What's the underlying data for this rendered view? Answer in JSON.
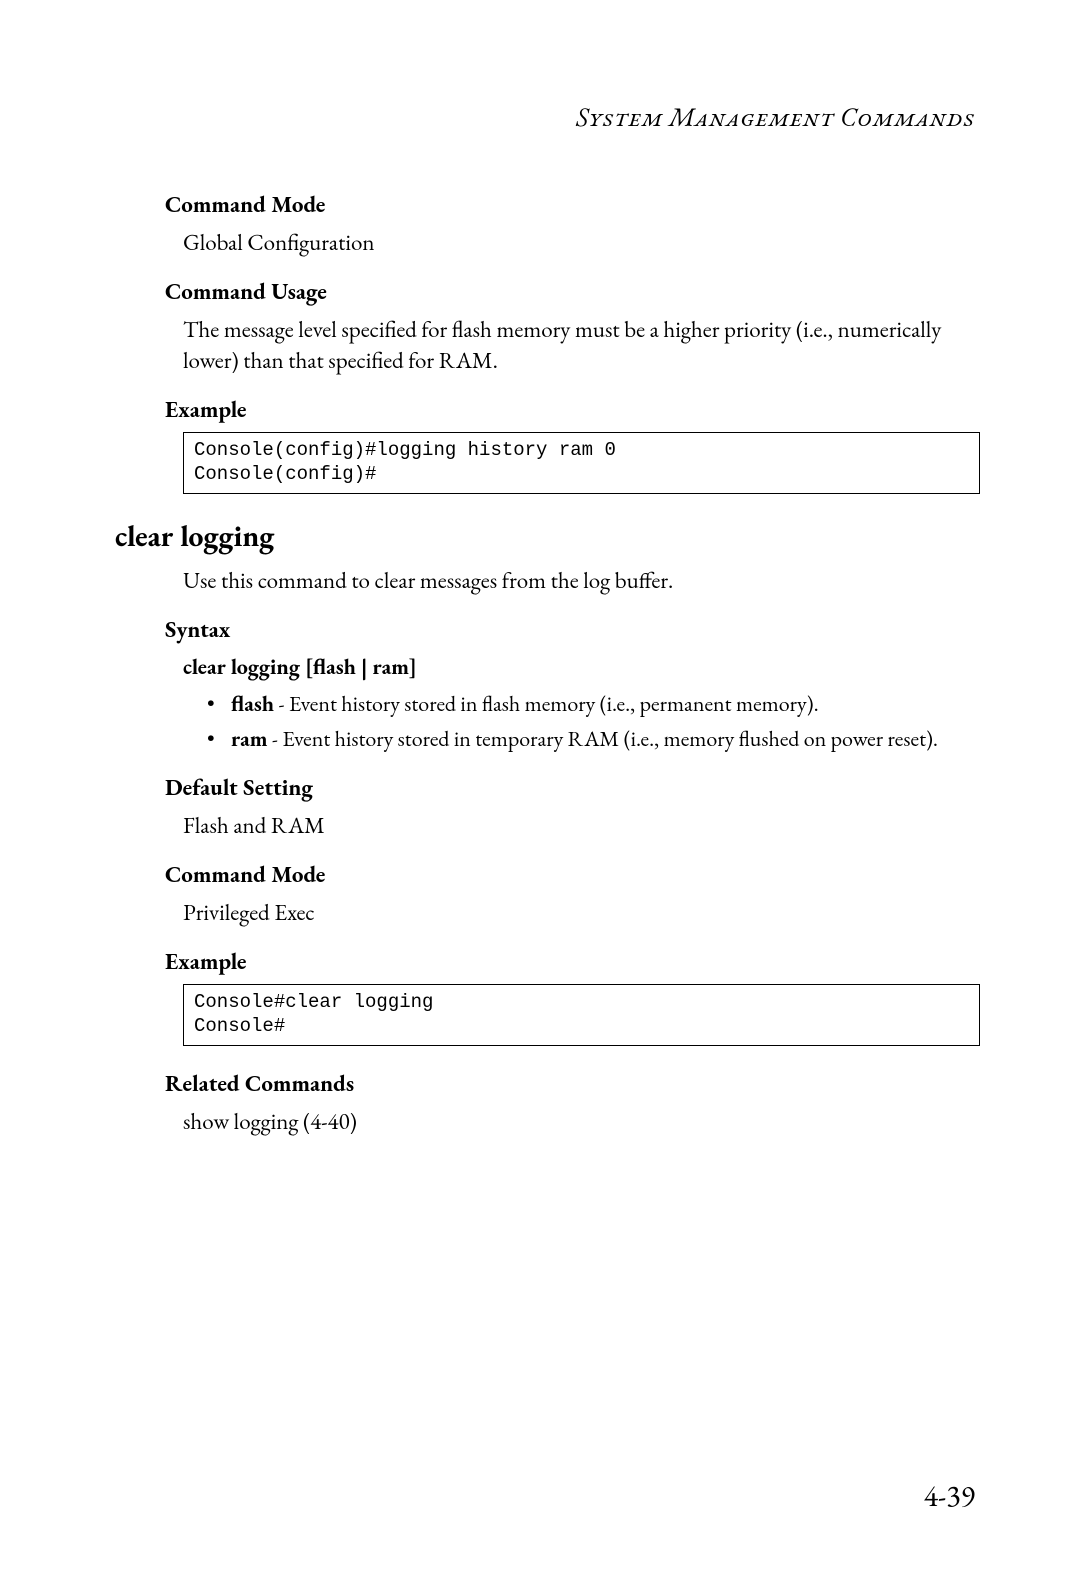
{
  "header": {
    "running_head": "System Management Commands"
  },
  "sections": {
    "cmd_mode_1": {
      "title": "Command Mode",
      "body": "Global Configuration"
    },
    "cmd_usage": {
      "title": "Command Usage",
      "body": "The message level specified for flash memory must be a higher priority (i.e., numerically lower) than that specified for RAM."
    },
    "example_1": {
      "title": "Example",
      "code": "Console(config)#logging history ram 0\nConsole(config)#"
    },
    "clear_logging": {
      "title": "clear logging",
      "intro": "Use this command to clear messages from the log buffer.",
      "syntax_title": "Syntax",
      "syntax_line": "clear logging [flash | ram]",
      "params": {
        "flash": {
          "name": "flash",
          "desc": " - Event history stored in flash memory (i.e., permanent memory)."
        },
        "ram": {
          "name": "ram",
          "desc": " - Event history stored in temporary RAM (i.e., memory flushed on power reset)."
        }
      },
      "default_title": "Default Setting",
      "default_body": "Flash and RAM",
      "mode_title": "Command Mode",
      "mode_body": "Privileged Exec",
      "example_title": "Example",
      "example_code": "Console#clear logging\nConsole#",
      "related_title": "Related Commands",
      "related_body": "show logging (4-40)"
    }
  },
  "page_number": "4-39"
}
